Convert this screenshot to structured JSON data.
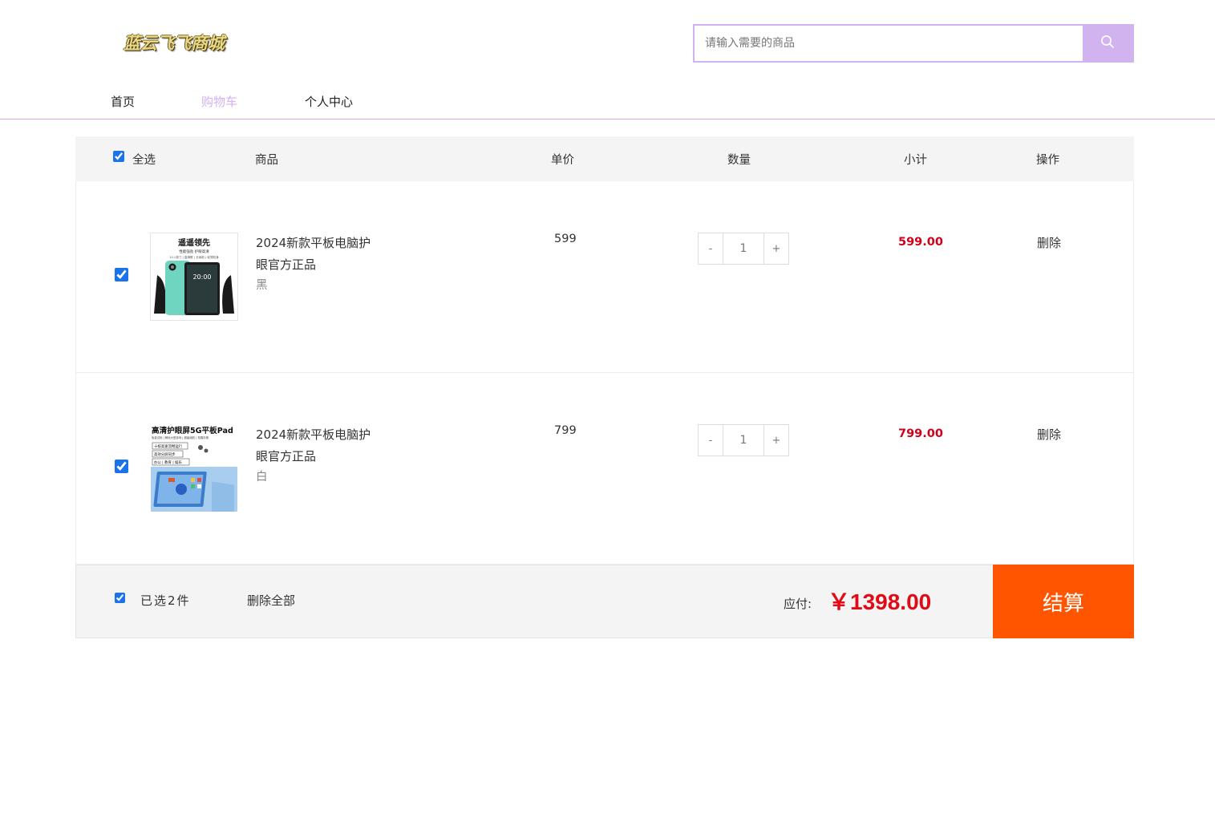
{
  "header": {
    "logo_text": "蓝云飞飞商城",
    "search": {
      "placeholder": "请输入需要的商品",
      "value": ""
    }
  },
  "nav": {
    "items": [
      {
        "label": "首页",
        "active": false
      },
      {
        "label": "购物车",
        "active": true
      },
      {
        "label": "个人中心",
        "active": false
      }
    ]
  },
  "cart": {
    "columns": {
      "select_all": "全选",
      "product": "商品",
      "unit_price": "单价",
      "quantity": "数量",
      "subtotal": "小计",
      "action": "操作"
    },
    "items": [
      {
        "checked": true,
        "name": "2024新款平板电脑护眼官方正品",
        "spec": "黑",
        "price": "599",
        "qty_minus": "-",
        "quantity": "1",
        "qty_plus": "+",
        "subtotal": "599.00",
        "delete": "删除",
        "image": {
          "headline": "遥遥领先",
          "subline": "性能强劲 护眼高清",
          "specs": "10.1英寸 | 高清屏 | 长续航 | 轻薄机身",
          "screen_time": "20:00"
        }
      },
      {
        "checked": true,
        "name": "2024新款平板电脑护眼官方正品",
        "spec": "白",
        "price": "799",
        "qty_minus": "-",
        "quantity": "1",
        "qty_plus": "+",
        "subtotal": "799.00",
        "delete": "删除",
        "image": {
          "headline": "高清护眼屏5G平板Pad",
          "subline": "免费试用 | 畅玩大型游戏 | 超级续航 | 拓展存储",
          "tags": [
            "十核高速流畅运行",
            "高效分屏同步",
            "办公 | 教育 | 娱乐"
          ]
        }
      }
    ],
    "footer": {
      "select_all_checked": true,
      "selected_text": "已选2件",
      "delete_all": "删除全部",
      "pay_label": "应付:",
      "total": "￥1398.00",
      "checkout": "结算"
    }
  },
  "colors": {
    "accent": "#d1b3f0",
    "price_red": "#d0021b",
    "checkout_orange": "#ff5500",
    "header_bg": "#f4f4f4"
  }
}
